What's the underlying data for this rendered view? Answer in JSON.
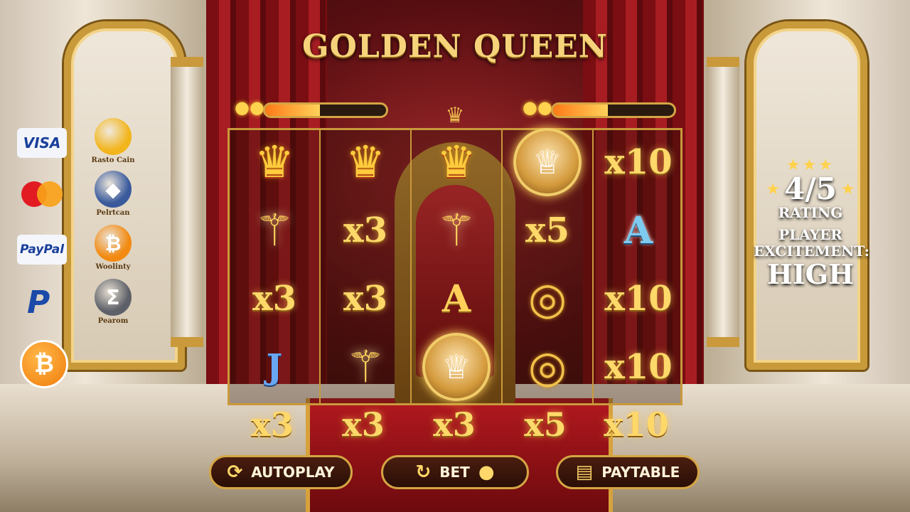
{
  "game": {
    "title": "GOLDEN QUEEN"
  },
  "meters": {
    "left_progress": 0.45,
    "right_progress": 0.45
  },
  "reels": [
    [
      {
        "symbol": "crown",
        "icon": "crown-icon"
      },
      {
        "symbol": "scepter",
        "icon": "scepter-icon"
      },
      {
        "symbol": "text",
        "text": "x3"
      },
      {
        "symbol": "text",
        "text": "J"
      }
    ],
    [
      {
        "symbol": "crown",
        "icon": "crown-icon"
      },
      {
        "symbol": "text",
        "text": "x3"
      },
      {
        "symbol": "text",
        "text": "x3"
      },
      {
        "symbol": "scepter",
        "icon": "scepter-icon"
      }
    ],
    [
      {
        "symbol": "crown",
        "icon": "crown-icon"
      },
      {
        "symbol": "scepter",
        "icon": "scepter-icon"
      },
      {
        "symbol": "text",
        "text": "A"
      },
      {
        "symbol": "queen",
        "icon": "queen-portrait-icon"
      }
    ],
    [
      {
        "symbol": "queen",
        "icon": "queen-portrait-icon"
      },
      {
        "symbol": "text",
        "text": "x5"
      },
      {
        "symbol": "ring",
        "icon": "ring-icon"
      },
      {
        "symbol": "ring",
        "icon": "ring-icon"
      }
    ],
    [
      {
        "symbol": "text",
        "text": "x10"
      },
      {
        "symbol": "text",
        "text": "A"
      },
      {
        "symbol": "text",
        "text": "x10"
      },
      {
        "symbol": "text",
        "text": "x10"
      }
    ]
  ],
  "bottom_multipliers": [
    "x3",
    "x3",
    "x3",
    "x5",
    "x10"
  ],
  "buttons": {
    "autoplay": "AUTOPLAY",
    "bet": "BET",
    "paytable": "PAYTABLE"
  },
  "payments": {
    "visa": "VISA",
    "paypal": "PayPal",
    "bitcoin_symbol": "₿",
    "crypto": [
      {
        "label": "Rasto Cain",
        "symbol": "",
        "color": "#f2b51c"
      },
      {
        "label": "Pelrtcan",
        "symbol": "◆",
        "color": "#3a5a9c"
      },
      {
        "label": "Woolinty",
        "symbol": "₿",
        "color": "#f28a12"
      },
      {
        "label": "Pearom",
        "symbol": "Σ",
        "color": "#5d6068"
      }
    ]
  },
  "rating": {
    "value": "4/5",
    "label": "RATING",
    "excitement_label": "PLAYER EXCITEMENT:",
    "excitement_value": "HIGH"
  },
  "colors": {
    "gold": "#ffd86a",
    "accent_red": "#a81d22"
  }
}
